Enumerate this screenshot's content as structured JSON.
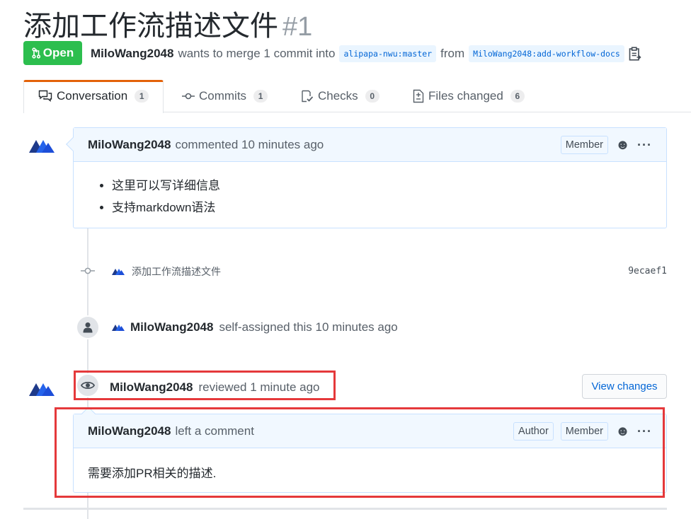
{
  "pr": {
    "title": "添加工作流描述文件",
    "number": "#1",
    "state": "Open",
    "author": "MiloWang2048",
    "merge_text": "wants to merge 1 commit into",
    "base_branch": "alipapa-nwu:master",
    "from_text": "from",
    "head_branch": "MiloWang2048:add-workflow-docs"
  },
  "tabs": [
    {
      "label": "Conversation",
      "count": "1",
      "icon": "comment-discussion-icon"
    },
    {
      "label": "Commits",
      "count": "1",
      "icon": "git-commit-icon"
    },
    {
      "label": "Checks",
      "count": "0",
      "icon": "checklist-icon"
    },
    {
      "label": "Files changed",
      "count": "6",
      "icon": "file-diff-icon"
    }
  ],
  "comment1": {
    "author": "MiloWang2048",
    "action": "commented 10 minutes ago",
    "role": "Member",
    "body": [
      "这里可以写详细信息",
      "支持markdown语法"
    ]
  },
  "commit": {
    "message": "添加工作流描述文件",
    "sha": "9ecaef1"
  },
  "assign_event": {
    "author": "MiloWang2048",
    "text": "self-assigned this 10 minutes ago"
  },
  "review_event": {
    "author": "MiloWang2048",
    "text": "reviewed 1 minute ago",
    "button": "View changes"
  },
  "review_comment": {
    "author": "MiloWang2048",
    "action": "left a comment",
    "role1": "Author",
    "role2": "Member",
    "body": "需要添加PR相关的描述."
  },
  "colors": {
    "open_green": "#2cbe4e",
    "link_blue": "#0366d6",
    "highlight_red": "#e5393b",
    "tab_accent": "#e36209"
  }
}
